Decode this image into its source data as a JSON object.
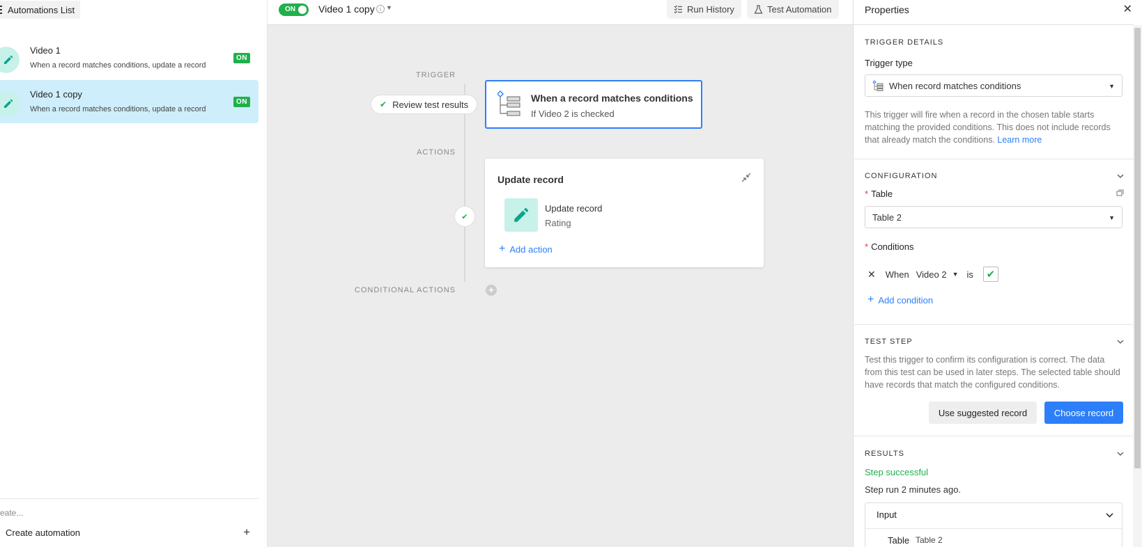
{
  "left_panel": {
    "header_label": "Automations List",
    "automations": [
      {
        "name": "Video 1",
        "description": "When a record matches conditions, update a record",
        "status": "ON"
      },
      {
        "name": "Video 1 copy",
        "description": "When a record matches conditions, update a record",
        "status": "ON"
      }
    ],
    "footer": {
      "search_text": "eate...",
      "create_label": "Create automation",
      "plus": "+"
    }
  },
  "topbar": {
    "toggle_label": "ON",
    "automation_title": "Video 1 copy",
    "info_icon": "i",
    "run_history_label": "Run History",
    "test_automation_label": "Test Automation"
  },
  "canvas": {
    "trigger_label": "TRIGGER",
    "actions_label": "ACTIONS",
    "conditional_actions_label": "CONDITIONAL ACTIONS",
    "review_label": "Review test results",
    "review_check": "✔",
    "trigger_card": {
      "title": "When a record matches conditions",
      "subtitle": "If Video 2 is checked"
    },
    "action_card": {
      "title": "Update record",
      "action_name": "Update record",
      "action_field": "Rating",
      "add_action_label": "Add action",
      "plus": "+"
    },
    "step_check": "✔",
    "add_conditional_icon": "+"
  },
  "properties": {
    "title": "Properties",
    "close": "✕",
    "trigger_details_label": "TRIGGER DETAILS",
    "trigger_type_label": "Trigger type",
    "trigger_type_value": "When record matches conditions",
    "trigger_description": "This trigger will fire when a record in the chosen table starts matching the provided conditions. This does not include records that already match the conditions.",
    "learn_more": "Learn more",
    "configuration_label": "CONFIGURATION",
    "required_mark": "*",
    "table_label": "Table",
    "table_value": "Table 2",
    "conditions_label": "Conditions",
    "condition": {
      "remove": "✕",
      "when": "When",
      "field": "Video 2",
      "operator": "is",
      "checked_mark": "✔"
    },
    "add_condition_label": "Add condition",
    "plus": "+",
    "test_step_label": "TEST STEP",
    "test_step_description": "Test this trigger to confirm its configuration is correct. The data from this test can be used in later steps. The selected table should have records that match the configured conditions.",
    "use_suggested_label": "Use suggested record",
    "choose_record_label": "Choose record",
    "results_label": "RESULTS",
    "step_status": "Step successful",
    "step_time": "Step run 2 minutes ago.",
    "input_label": "Input",
    "input_table_key": "Table",
    "input_table_value": "Table 2"
  },
  "colors": {
    "accent_blue": "#2d7ff9",
    "success_green": "#20b04b",
    "selected_row": "#cdeefa",
    "icon_teal_bg": "#c7f1e9",
    "canvas_bg": "#ececec"
  }
}
